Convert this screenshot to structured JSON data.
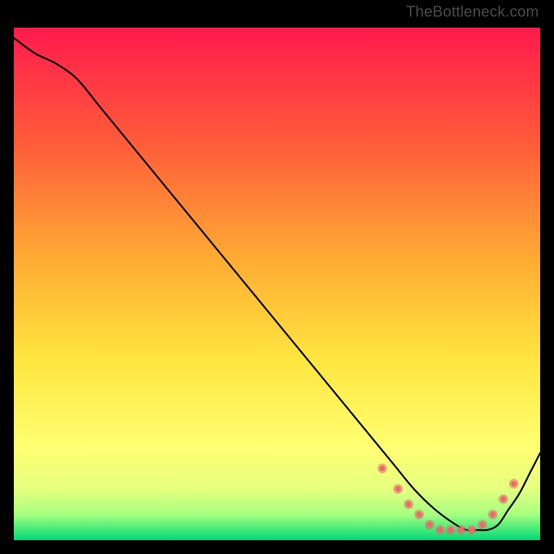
{
  "attribution": "TheBottleneck.com",
  "chart_data": {
    "type": "line",
    "title": "",
    "xlabel": "",
    "ylabel": "",
    "xlim": [
      0,
      100
    ],
    "ylim": [
      0,
      100
    ],
    "grid": false,
    "legend": false,
    "background_gradient": {
      "top": "#ff1a4d",
      "mid_upper": "#ff7a33",
      "mid": "#ffd633",
      "mid_lower": "#ffff66",
      "lower": "#ccff66",
      "bottom": "#00e673"
    },
    "series": [
      {
        "name": "curve",
        "x": [
          0,
          4,
          8,
          12,
          16,
          20,
          24,
          28,
          32,
          36,
          40,
          44,
          48,
          52,
          56,
          60,
          64,
          68,
          72,
          76,
          80,
          84,
          86,
          88,
          90,
          92,
          94,
          96,
          98,
          100
        ],
        "y": [
          98,
          95,
          93,
          90,
          85,
          80,
          75,
          70,
          65,
          60,
          55,
          50,
          45,
          40,
          35,
          30,
          25,
          20,
          15,
          10,
          6,
          3,
          2,
          2,
          2,
          3,
          6,
          9,
          13,
          17
        ]
      }
    ],
    "markers": {
      "name": "highlight-points",
      "color": "#e86a6a",
      "radius_outer": 7,
      "radius_inner": 4,
      "x": [
        70,
        73,
        75,
        77,
        79,
        81,
        83,
        85,
        87,
        89,
        91,
        93,
        95
      ],
      "y": [
        14,
        10,
        7,
        5,
        3,
        2,
        2,
        2,
        2,
        3,
        5,
        8,
        11
      ]
    }
  }
}
